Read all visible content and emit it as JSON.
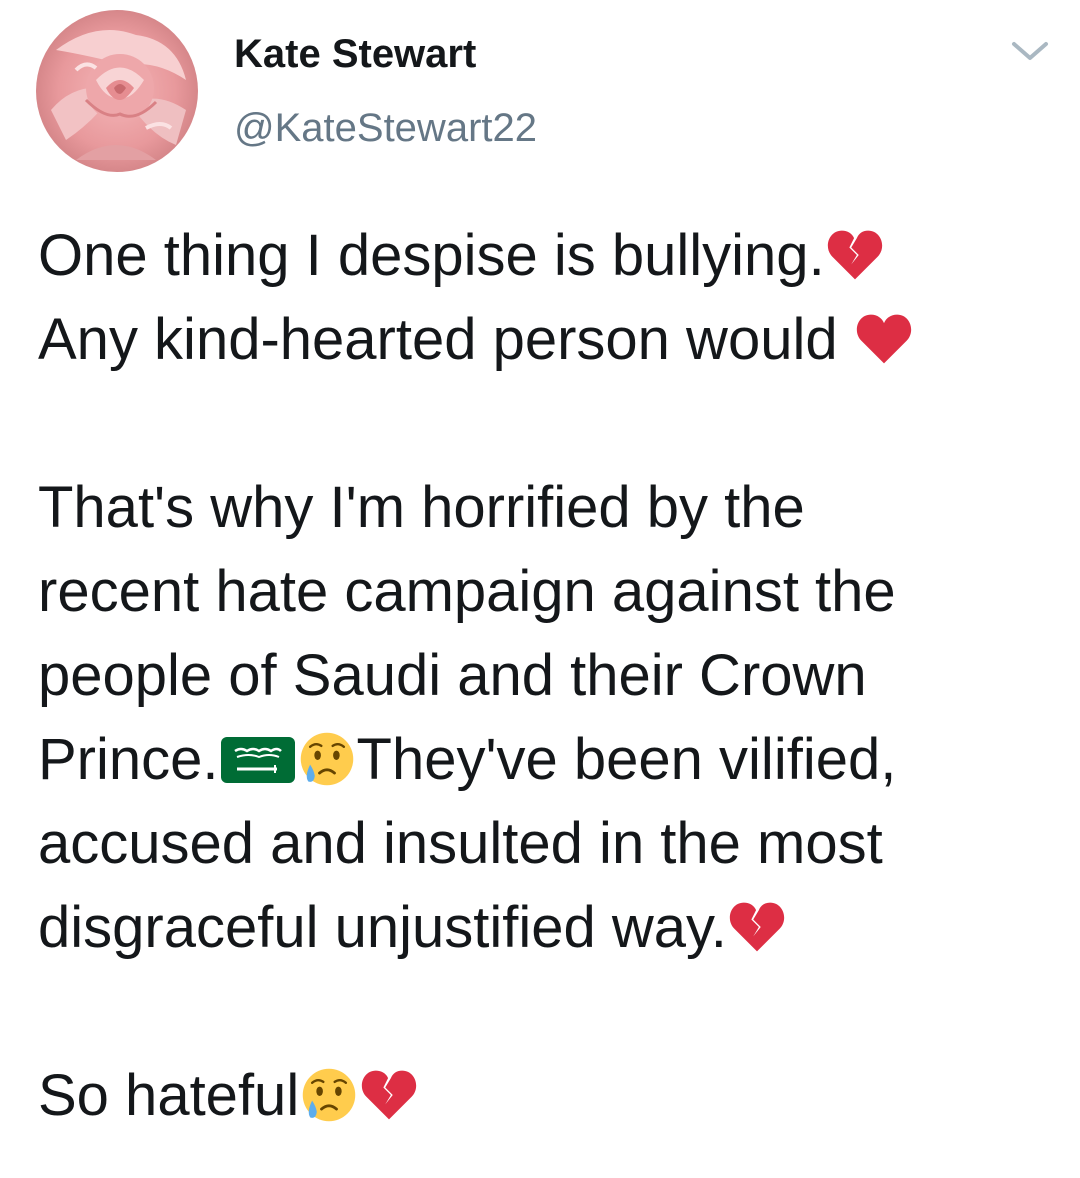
{
  "tweet": {
    "author": {
      "display_name": "Kate Stewart",
      "handle": "@KateStewart22",
      "avatar_icon": "rose-avatar"
    },
    "menu_icon": "chevron-down-icon",
    "text": {
      "p1_line1": "One thing I despise is bullying.",
      "p1_line2": "Any kind-hearted person would ",
      "p2_line1": "That's why I'm horrified by the",
      "p2_line2": "recent hate campaign against the",
      "p2_line3": "people of Saudi and their Crown",
      "p2_line4a": "Prince.",
      "p2_line4b": "They've been vilified,",
      "p2_line5": "accused and insulted in the most",
      "p2_line6": "disgraceful unjustified way.",
      "p3_line1": "So hateful"
    },
    "emoji": {
      "broken_heart": "broken-heart-emoji",
      "red_heart": "red-heart-emoji",
      "saudi_flag": "saudi-arabia-flag-emoji",
      "crying_face": "crying-face-emoji"
    },
    "colors": {
      "text": "#14171a",
      "handle": "#657786",
      "heart": "#dd2e44",
      "flag_green": "#006c35",
      "face": "#ffcc4d",
      "tear": "#5dadec"
    }
  }
}
